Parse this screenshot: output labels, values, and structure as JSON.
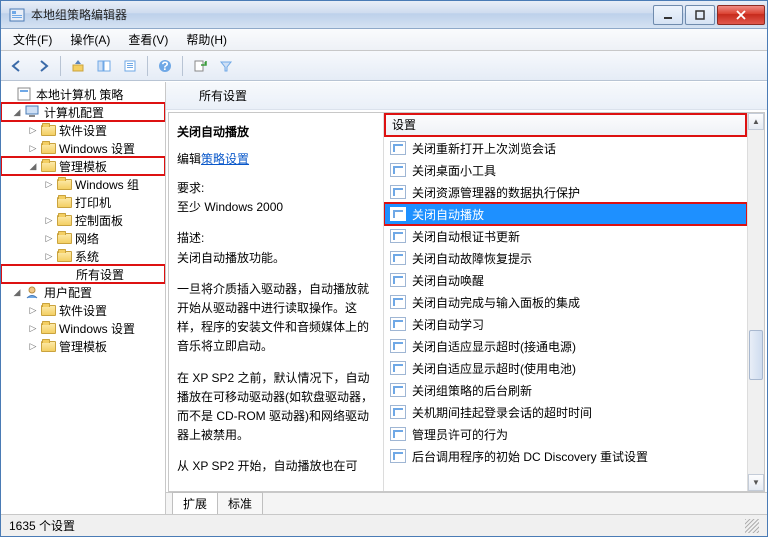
{
  "window": {
    "title": "本地组策略编辑器"
  },
  "menu": {
    "file": "文件(F)",
    "action": "操作(A)",
    "view": "查看(V)",
    "help": "帮助(H)"
  },
  "tree": {
    "root": "本地计算机 策略",
    "computer_cfg": "计算机配置",
    "software": "软件设置",
    "windows_settings": "Windows 设置",
    "admin_templates": "管理模板",
    "windows_group": "Windows 组",
    "printers": "打印机",
    "control_panel": "控制面板",
    "network": "网络",
    "system": "系统",
    "all_settings": "所有设置",
    "user_cfg": "用户配置",
    "u_software": "软件设置",
    "u_windows": "Windows 设置",
    "u_admin": "管理模板"
  },
  "right": {
    "header": "所有设置"
  },
  "detail": {
    "title": "关闭自动播放",
    "edit_prefix": "编辑",
    "edit_link": "策略设置",
    "req_label": "要求:",
    "req_value": "至少 Windows 2000",
    "desc_label": "描述:",
    "desc_value": "关闭自动播放功能。",
    "para1": "一旦将介质插入驱动器，自动播放就开始从驱动器中进行读取操作。这样，程序的安装文件和音频媒体上的音乐将立即启动。",
    "para2": "在 XP SP2 之前，默认情况下，自动播放在可移动驱动器(如软盘驱动器，而不是 CD-ROM 驱动器)和网络驱动器上被禁用。",
    "para3": "从 XP SP2 开始，自动播放也在可"
  },
  "list": {
    "column": "设置",
    "items": [
      "关闭重新打开上次浏览会话",
      "关闭桌面小工具",
      "关闭资源管理器的数据执行保护",
      "关闭自动播放",
      "关闭自动根证书更新",
      "关闭自动故障恢复提示",
      "关闭自动唤醒",
      "关闭自动完成与输入面板的集成",
      "关闭自动学习",
      "关闭自适应显示超时(接通电源)",
      "关闭自适应显示超时(使用电池)",
      "关闭组策略的后台刷新",
      "关机期间挂起登录会话的超时时间",
      "管理员许可的行为",
      "后台调用程序的初始 DC Discovery 重试设置"
    ],
    "selected_index": 3
  },
  "tabs": {
    "extend": "扩展",
    "standard": "标准"
  },
  "status": {
    "text": "1635 个设置"
  }
}
